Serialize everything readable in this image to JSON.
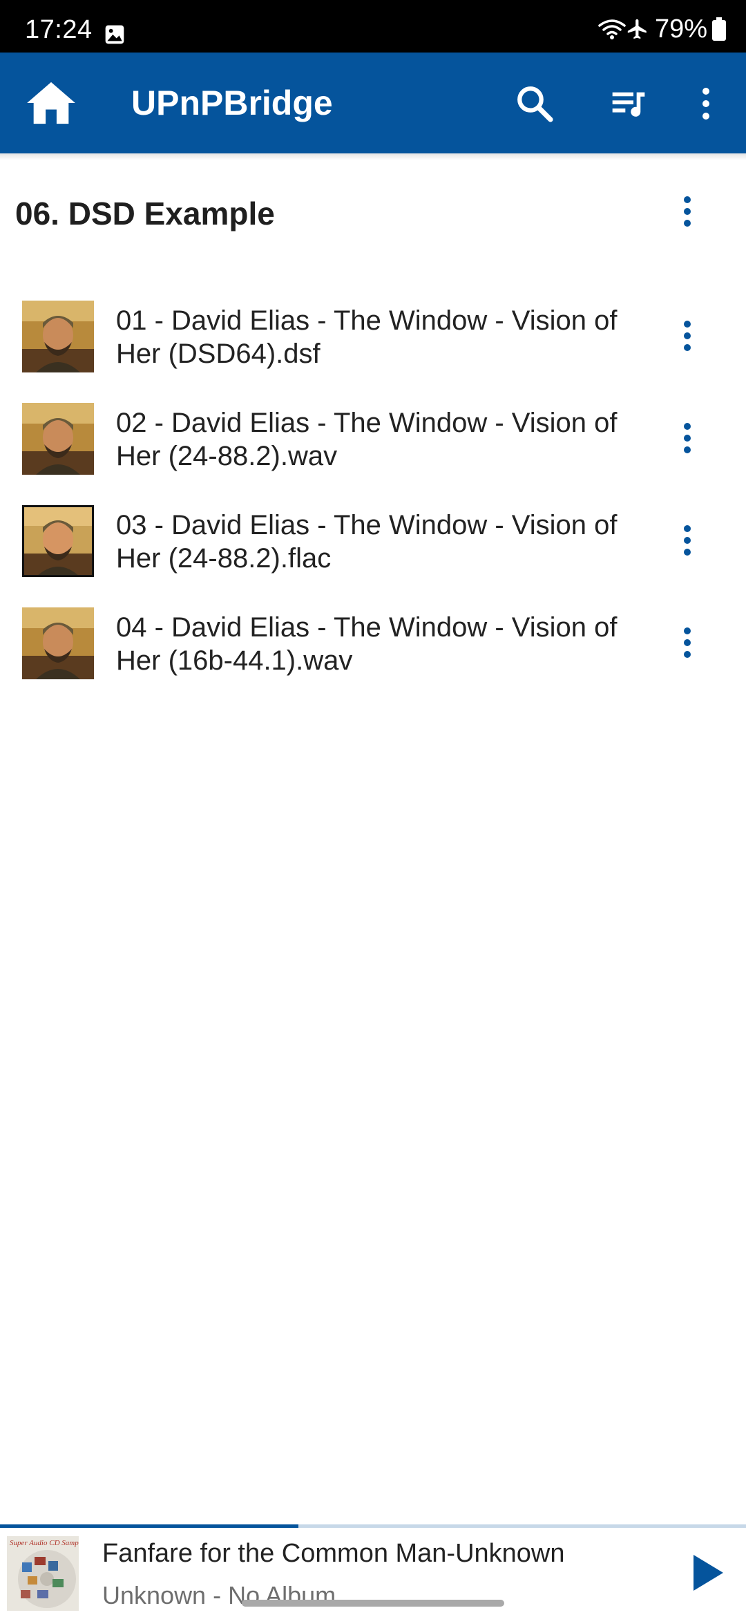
{
  "status_bar": {
    "time": "17:24",
    "battery": "79%",
    "icons": [
      "gallery-icon",
      "wifi-icon",
      "airplane-icon",
      "battery-icon"
    ]
  },
  "app_bar": {
    "title": "UPnPBridge",
    "icons": [
      "home-icon",
      "search-icon",
      "queue-music-icon",
      "more-vert-icon"
    ],
    "background": "#05549c"
  },
  "folder": {
    "title": "06. DSD Example"
  },
  "tracks": [
    {
      "title": "01 - David Elias - The Window - Vision of Her (DSD64).dsf"
    },
    {
      "title": "02 - David Elias - The Window - Vision of Her (24-88.2).wav"
    },
    {
      "title": "03 - David Elias - The Window - Vision of Her (24-88.2).flac"
    },
    {
      "title": "04 - David Elias - The Window - Vision of Her (16b-44.1).wav"
    }
  ],
  "now_playing": {
    "title": "Fanfare for the Common Man-Unknown",
    "subtitle": "Unknown - No Album",
    "art_text": "Super Audio CD Sampler",
    "progress": 0.4
  },
  "colors": {
    "accent": "#05549c",
    "status_bar": "#000000",
    "text": "#222222",
    "subtext": "#6e6e6e"
  }
}
